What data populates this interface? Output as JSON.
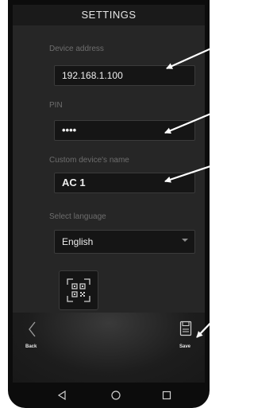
{
  "header": {
    "title": "SETTINGS"
  },
  "form": {
    "device_address": {
      "label": "Device address",
      "value": "192.168.1.100"
    },
    "pin": {
      "label": "PIN",
      "value": "••••"
    },
    "device_name": {
      "label": "Custom device's name",
      "value": "AC 1"
    },
    "language": {
      "label": "Select language",
      "value": "English"
    }
  },
  "bottom_bar": {
    "back_label": "Back",
    "save_label": "Save"
  },
  "icons": {
    "qr": "qr-code-icon",
    "back": "chevron-left-icon",
    "save": "save-document-icon",
    "nav_back": "triangle-back-icon",
    "nav_home": "circle-home-icon",
    "nav_recents": "square-recents-icon"
  },
  "colors": {
    "screen_bg": "#262626",
    "field_bg": "#151515",
    "label": "#6d6d6d",
    "arrow": "#ffffff"
  }
}
